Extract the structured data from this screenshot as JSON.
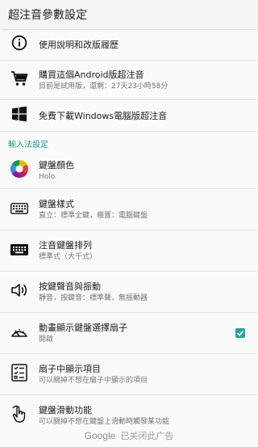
{
  "appbar": {
    "title": "超注音參數設定"
  },
  "items_top": [
    {
      "key": "help",
      "icon": "info-icon",
      "title": "使用說明和改版履歷"
    },
    {
      "key": "buy",
      "icon": "cart-icon",
      "title": "購買這個Android版超注音",
      "summary": "目前是試用版，還剩：27天23小時58分"
    },
    {
      "key": "windows",
      "icon": "windows-logo-icon",
      "title": "免費下載Windows電腦版超注音"
    }
  ],
  "section": {
    "label": "輸入法設定"
  },
  "items_ime": [
    {
      "key": "color",
      "icon": "color-wheel-icon",
      "title": "鍵盤顏色",
      "summary": "Holo"
    },
    {
      "key": "style",
      "icon": "keyboard-icon",
      "title": "鍵盤樣式",
      "summary": "直立：標準全鍵，橫置：電腦鍵盤"
    },
    {
      "key": "layout",
      "icon": "keyboard-dark-icon",
      "title": "注音鍵盤排列",
      "summary": "標準式（大千式）"
    },
    {
      "key": "sound",
      "icon": "speaker-icon",
      "title": "按鍵聲音與振動",
      "summary": "靜音，按鍵音：標準聲，無振動器"
    },
    {
      "key": "fan",
      "icon": "fan-gauge-icon",
      "title": "動畫顯示鍵盤選擇扇子",
      "summary": "開啟",
      "checked": true
    },
    {
      "key": "fanitems",
      "icon": "checklist-icon",
      "title": "扇子中顯示項目",
      "summary": "可以關掉不想在扇子中顯示的項目"
    },
    {
      "key": "swipe",
      "icon": "swipe-hand-icon",
      "title": "鍵盤滑動功能",
      "summary": "可以關掉不想在鍵盤上滑動時觸發某功能"
    }
  ],
  "ad": {
    "brand": "Google",
    "text": "已关闭此广告"
  }
}
